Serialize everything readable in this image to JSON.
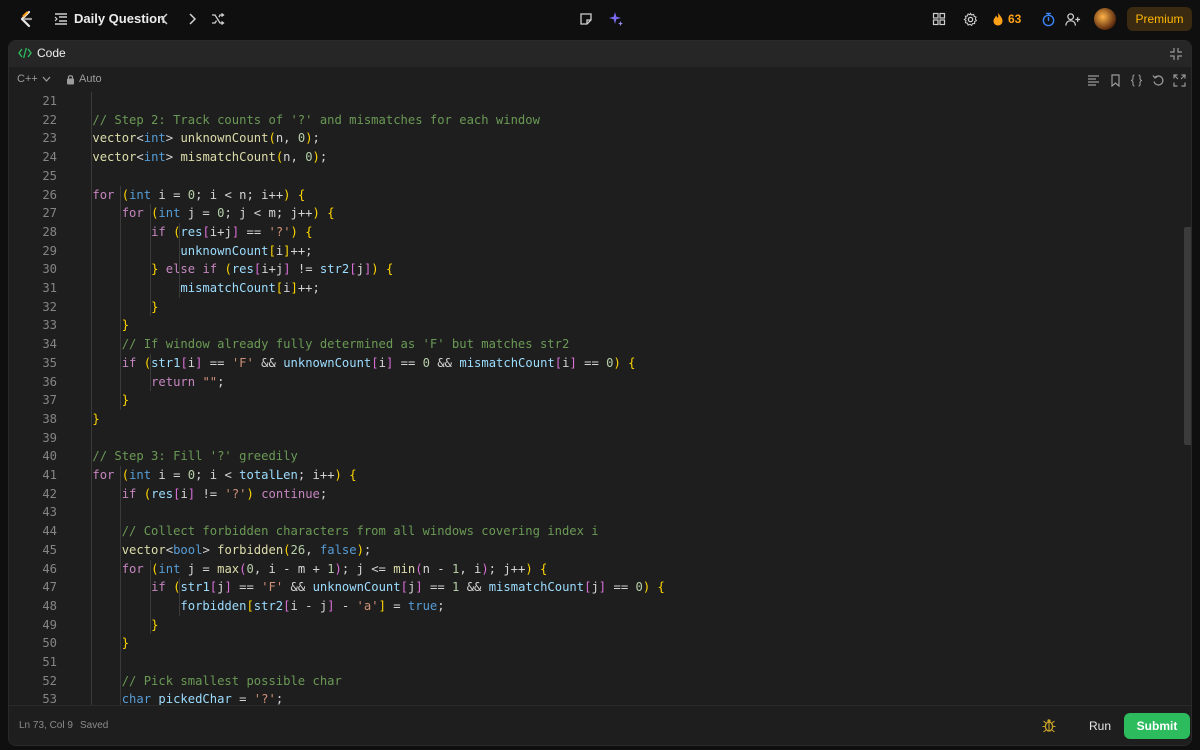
{
  "topbar": {
    "title": "Daily Question",
    "streak_count": "63",
    "premium_label": "Premium",
    "icons": [
      "leetcode-logo-icon",
      "problem-list-icon",
      "prev-chevron-icon",
      "next-chevron-icon",
      "shuffle-icon",
      "note-icon",
      "sparkle-icon",
      "layout-icon",
      "settings-gear-icon",
      "fire-icon",
      "timer-icon",
      "add-user-icon",
      "avatar"
    ]
  },
  "panel": {
    "tab_label": "Code",
    "language": "C++",
    "mode": "Auto"
  },
  "editor": {
    "lines": [
      {
        "n": "21",
        "t": ""
      },
      {
        "n": "22",
        "t": "    // Step 2: Track counts of '?' and mismatches for each window"
      },
      {
        "n": "23",
        "t": "    vector<int> unknownCount(n, 0);"
      },
      {
        "n": "24",
        "t": "    vector<int> mismatchCount(n, 0);"
      },
      {
        "n": "25",
        "t": ""
      },
      {
        "n": "26",
        "t": "    for (int i = 0; i < n; i++) {"
      },
      {
        "n": "27",
        "t": "        for (int j = 0; j < m; j++) {"
      },
      {
        "n": "28",
        "t": "            if (res[i+j] == '?') {"
      },
      {
        "n": "29",
        "t": "                unknownCount[i]++;"
      },
      {
        "n": "30",
        "t": "            } else if (res[i+j] != str2[j]) {"
      },
      {
        "n": "31",
        "t": "                mismatchCount[i]++;"
      },
      {
        "n": "32",
        "t": "            }"
      },
      {
        "n": "33",
        "t": "        }"
      },
      {
        "n": "34",
        "t": "        // If window already fully determined as 'F' but matches str2"
      },
      {
        "n": "35",
        "t": "        if (str1[i] == 'F' && unknownCount[i] == 0 && mismatchCount[i] == 0) {"
      },
      {
        "n": "36",
        "t": "            return \"\";"
      },
      {
        "n": "37",
        "t": "        }"
      },
      {
        "n": "38",
        "t": "    }"
      },
      {
        "n": "39",
        "t": ""
      },
      {
        "n": "40",
        "t": "    // Step 3: Fill '?' greedily"
      },
      {
        "n": "41",
        "t": "    for (int i = 0; i < totalLen; i++) {"
      },
      {
        "n": "42",
        "t": "        if (res[i] != '?') continue;"
      },
      {
        "n": "43",
        "t": ""
      },
      {
        "n": "44",
        "t": "        // Collect forbidden characters from all windows covering index i"
      },
      {
        "n": "45",
        "t": "        vector<bool> forbidden(26, false);"
      },
      {
        "n": "46",
        "t": "        for (int j = max(0, i - m + 1); j <= min(n - 1, i); j++) {"
      },
      {
        "n": "47",
        "t": "            if (str1[j] == 'F' && unknownCount[j] == 1 && mismatchCount[j] == 0) {"
      },
      {
        "n": "48",
        "t": "                forbidden[str2[i - j] - 'a'] = true;"
      },
      {
        "n": "49",
        "t": "            }"
      },
      {
        "n": "50",
        "t": "        }"
      },
      {
        "n": "51",
        "t": ""
      },
      {
        "n": "52",
        "t": "        // Pick smallest possible char"
      },
      {
        "n": "53",
        "t": "        char pickedChar = '?';"
      }
    ]
  },
  "status": {
    "cursor": "Ln 73, Col 9",
    "save_state": "Saved"
  },
  "actions": {
    "run_label": "Run",
    "submit_label": "Submit"
  },
  "colors": {
    "accent_green": "#2cbb5d",
    "streak_orange": "#ffa116",
    "premium_gold": "#ffb800"
  }
}
